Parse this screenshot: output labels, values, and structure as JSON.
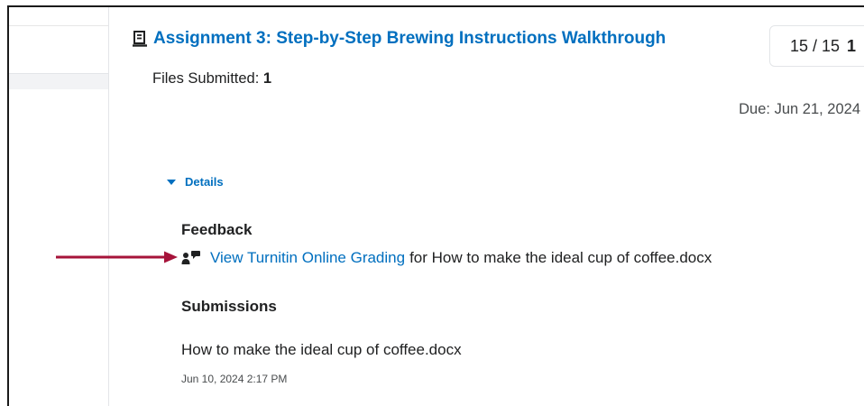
{
  "assignment": {
    "title": "Assignment 3: Step-by-Step Brewing Instructions Walkthrough",
    "files_submitted_label": "Files Submitted: ",
    "files_submitted_count": "1",
    "due": "Due: Jun 21, 2024",
    "icon": "assignment-doc-icon"
  },
  "score": {
    "value": "15 / 15",
    "extra": "1"
  },
  "details": {
    "toggle_label": "Details",
    "icon": "caret-down-icon"
  },
  "feedback": {
    "heading": "Feedback",
    "link_label": "View Turnitin Online Grading",
    "suffix": "for How to make the ideal cup of coffee.docx",
    "icon": "turnitin-feedback-icon"
  },
  "submissions": {
    "heading": "Submissions",
    "file_name": "How to make the ideal cup of coffee.docx",
    "date": "Jun 10, 2024 2:17 PM"
  },
  "colors": {
    "link": "#006fbf",
    "arrow": "#a6133a",
    "text": "#202122"
  }
}
